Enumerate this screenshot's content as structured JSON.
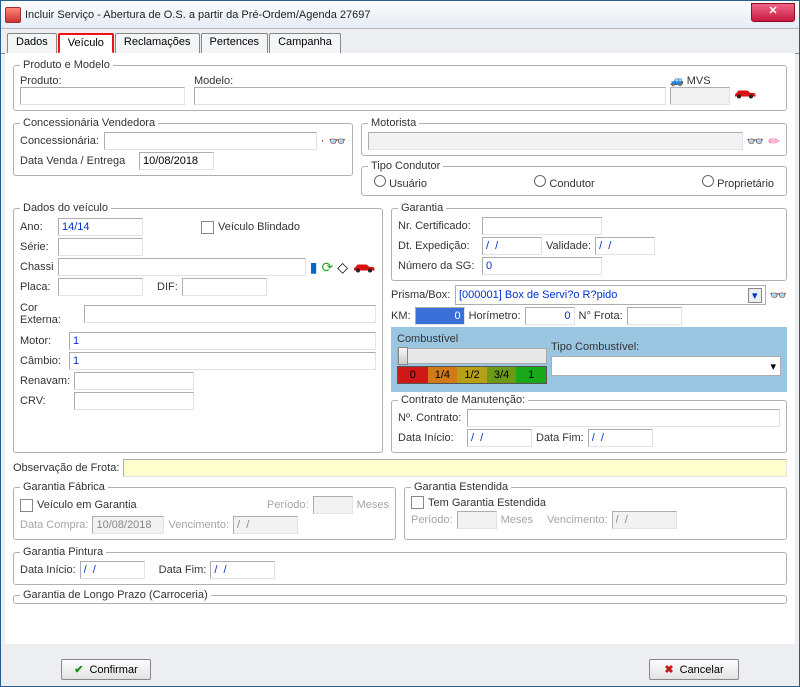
{
  "window": {
    "title": "Incluir Serviço - Abertura de O.S. a partir da Pré-Ordem/Agenda 27697"
  },
  "tabs": [
    "Dados",
    "Veículo",
    "Reclamações",
    "Pertences",
    "Campanha"
  ],
  "produtoModelo": {
    "legend": "Produto e Modelo",
    "produto_lbl": "Produto:",
    "modelo_lbl": "Modelo:",
    "mvs_lbl": "MVS",
    "produto": "",
    "modelo": "",
    "mvs": ""
  },
  "concess": {
    "legend": "Concessionária Vendedora",
    "lbl": "Concessionária:",
    "val": "",
    "data_lbl": "Data Venda / Entrega",
    "data_val": "10/08/2018"
  },
  "motorista": {
    "legend": "Motorista",
    "val": ""
  },
  "tipoCondutor": {
    "legend": "Tipo Condutor",
    "usuario": "Usuário",
    "condutor": "Condutor",
    "proprietario": "Proprietário"
  },
  "dadosVeiculo": {
    "legend": "Dados do veículo",
    "ano_lbl": "Ano:",
    "ano": "14/14",
    "blindado": "Veículo Blindado",
    "serie_lbl": "Série:",
    "serie": "",
    "chassi_lbl": "Chassi",
    "chassi": "",
    "placa_lbl": "Placa:",
    "placa": "",
    "dif_lbl": "DIF:",
    "dif": "",
    "cor_lbl": "Cor Externa:",
    "cor": "",
    "motor_lbl": "Motor:",
    "motor": "1",
    "cambio_lbl": "Câmbio:",
    "cambio": "1",
    "renavam_lbl": "Renavam:",
    "renavam": "",
    "crv_lbl": "CRV:",
    "crv": ""
  },
  "garantia": {
    "legend": "Garantia",
    "nrcert_lbl": "Nr. Certificado:",
    "nrcert": "",
    "dtexp_lbl": "Dt. Expedição:",
    "dtexp": "/  /",
    "validade_lbl": "Validade:",
    "validade": "/  /",
    "sg_lbl": "Número da SG:",
    "sg": "0"
  },
  "prisma": {
    "lbl": "Prisma/Box:",
    "val": "[000001] Box de Servi?o R?pido"
  },
  "km": {
    "km_lbl": "KM:",
    "km": "0",
    "hor_lbl": "Horímetro:",
    "hor": "0",
    "frota_lbl": "N° Frota:",
    "frota": ""
  },
  "combust": {
    "legend": "Combustível",
    "g0": "0",
    "g1": "1/4",
    "g2": "1/2",
    "g3": "3/4",
    "g4": "1"
  },
  "tipoComb": {
    "legend": "Tipo Combustível:",
    "val": ""
  },
  "contrato": {
    "legend": "Contrato de Manutenção:",
    "nr_lbl": "Nº. Contrato:",
    "nr": "",
    "ini_lbl": "Data Início:",
    "ini": "/  /",
    "fim_lbl": "Data Fim:",
    "fim": "/  /"
  },
  "obsFrota": {
    "lbl": "Observação de Frota:",
    "val": ""
  },
  "garFab": {
    "legend": "Garantia Fábrica",
    "check": "Veículo em Garantia",
    "per_lbl": "Período:",
    "per": "",
    "meses": "Meses",
    "dtcompra_lbl": "Data Compra:",
    "dtcompra": "10/08/2018",
    "venc_lbl": "Vencimento:",
    "venc": "/  /"
  },
  "garEst": {
    "legend": "Garantia Estendida",
    "check": "Tem Garantia Estendida",
    "per_lbl": "Período:",
    "per": "",
    "meses": "Meses",
    "venc_lbl": "Vencimento:",
    "venc": "/  /"
  },
  "garPint": {
    "legend": "Garantia Pintura",
    "ini_lbl": "Data Início:",
    "ini": "/  /",
    "fim_lbl": "Data Fim:",
    "fim": "/  /"
  },
  "garLP": {
    "legend": "Garantia de Longo Prazo (Carroceria)"
  },
  "buttons": {
    "confirmar": "Confirmar",
    "cancelar": "Cancelar"
  }
}
